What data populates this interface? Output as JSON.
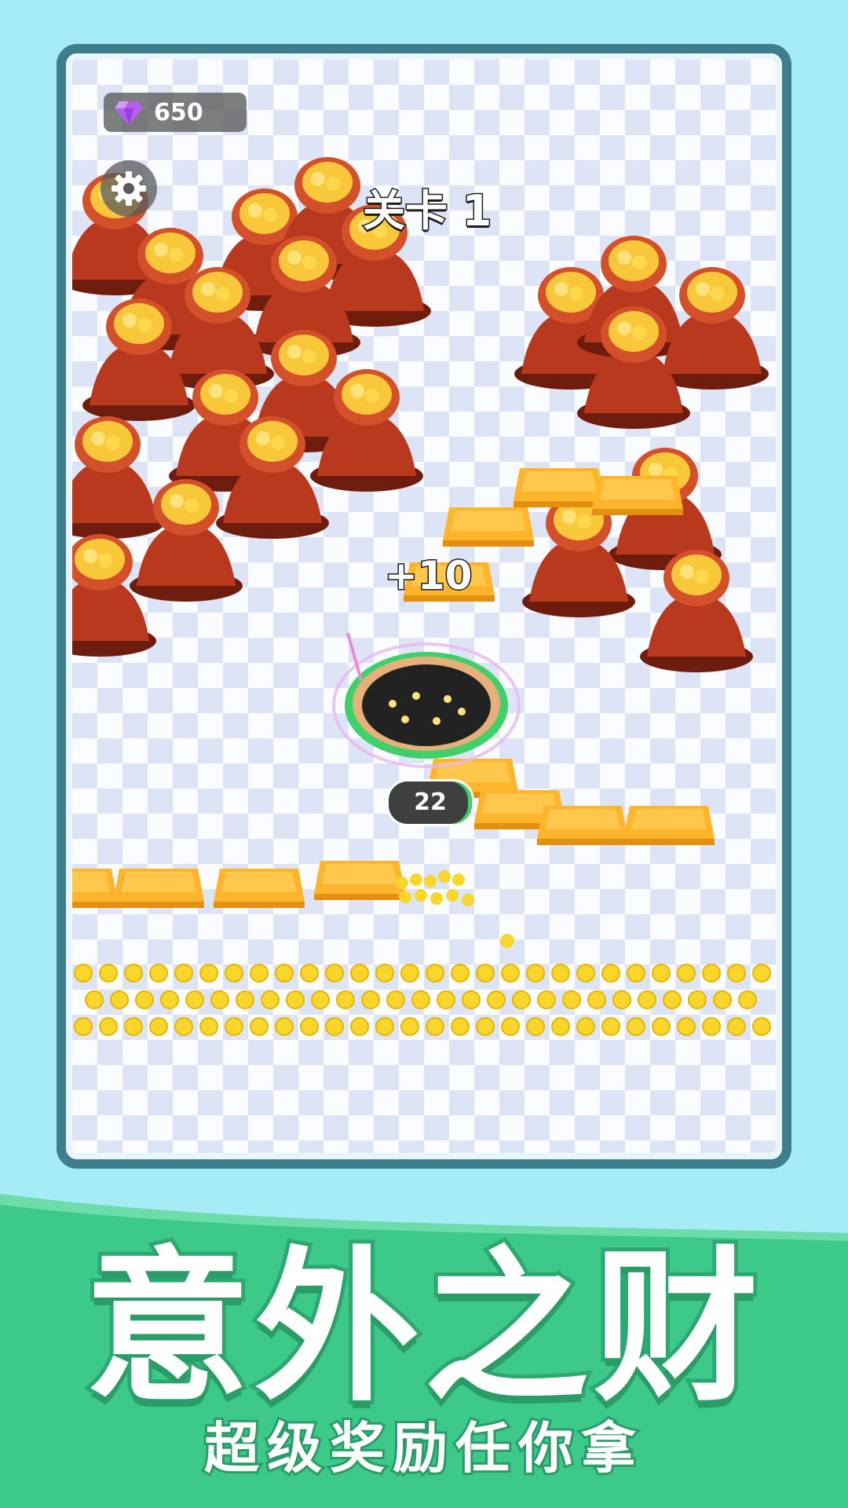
{
  "hud": {
    "gem_icon": "diamond-icon",
    "gem_count": "650",
    "settings_icon": "gear-icon",
    "level_title": "关卡 1"
  },
  "gameplay": {
    "score_popup": "+10",
    "hole_size": "22"
  },
  "promo": {
    "title": "意外之财",
    "subtitle": "超级奖励任你拿"
  },
  "colors": {
    "sky": "#a6ecf7",
    "frame_border": "#3f7e8c",
    "bag_red": "#b8391d",
    "gold": "#f9c83a",
    "bar_orange": "#ffb52b",
    "green": "#3fd06a",
    "promo_green": "#3cc98a"
  }
}
